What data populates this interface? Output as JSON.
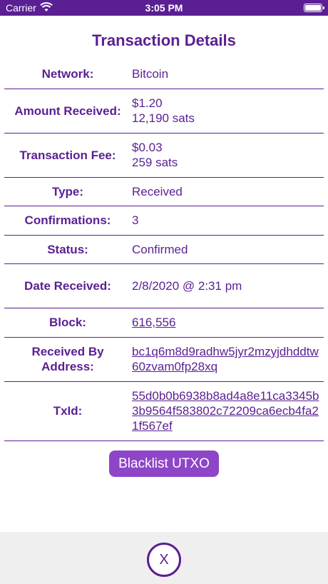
{
  "status_bar": {
    "carrier": "Carrier",
    "time": "3:05 PM",
    "wifi_icon": "wifi-icon",
    "battery_icon": "battery-icon"
  },
  "title": "Transaction Details",
  "rows": [
    {
      "label": "Network:",
      "value": [
        "Bitcoin"
      ]
    },
    {
      "label": "Amount Received:",
      "value": [
        "$1.20",
        "12,190 sats"
      ]
    },
    {
      "label": "Transaction Fee:",
      "value": [
        "$0.03",
        "259 sats"
      ]
    },
    {
      "label": "Type:",
      "value": [
        "Received"
      ]
    },
    {
      "label": "Confirmations:",
      "value": [
        "3"
      ]
    },
    {
      "label": "Status:",
      "value": [
        "Confirmed"
      ]
    },
    {
      "label": "Date Received:",
      "value": [
        "2/8/2020 @ 2:31 pm"
      ]
    },
    {
      "label": "Block:",
      "link": "616,556"
    },
    {
      "label": "Received By Address:",
      "link": "bc1q6m8d9radhw5jyr2mzyjdhddtw60zvam0fp28xq"
    },
    {
      "label": "TxId:",
      "link": "55d0b0b6938b8ad4a8e11ca3345b3b9564f583802c72209ca6ecb4fa21f567ef"
    }
  ],
  "blacklist_button": "Blacklist UTXO",
  "close_button": "X",
  "colors": {
    "accent": "#5a1f92",
    "button": "#8e45c8"
  }
}
